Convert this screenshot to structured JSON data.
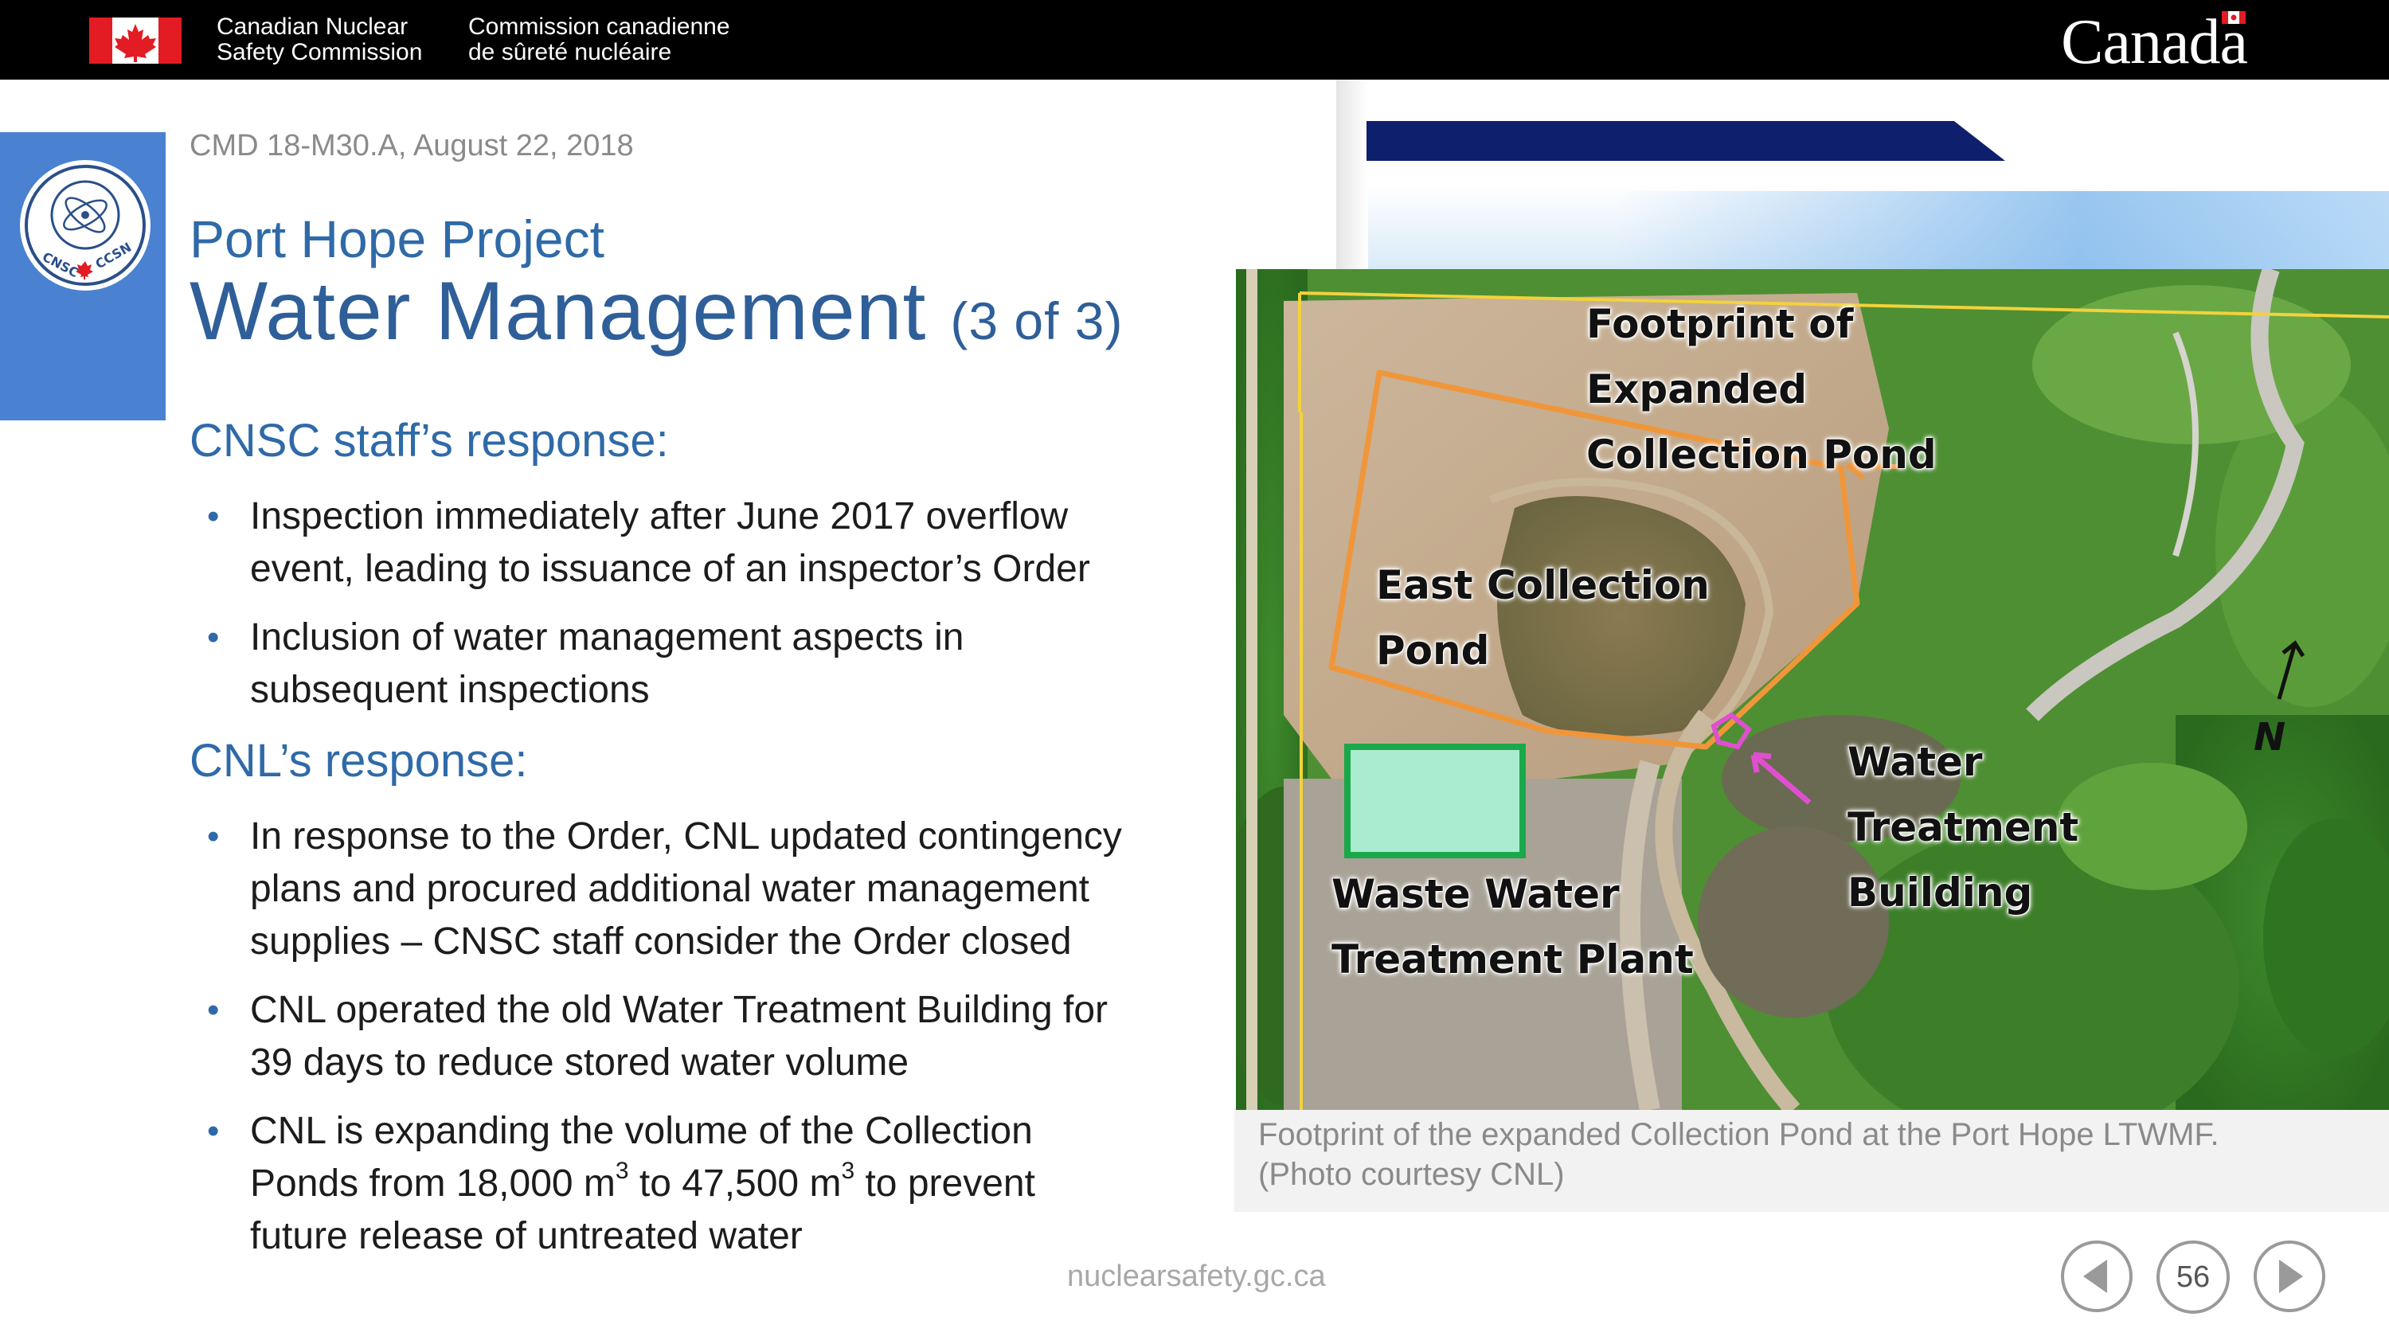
{
  "header": {
    "agency_en_line1": "Canadian Nuclear",
    "agency_en_line2": "Safety Commission",
    "agency_fr_line1": "Commission canadienne",
    "agency_fr_line2": "de sûreté nucléaire",
    "wordmark": "Canada",
    "flag_icon": "canada-flag-icon"
  },
  "logo": {
    "icon": "cnsc-ccsn-seal-icon",
    "text_left": "CNSC",
    "text_right": "CCSN"
  },
  "slide": {
    "reference": "CMD 18-M30.A, August 22, 2018",
    "project": "Port Hope Project",
    "title": "Water Management",
    "title_suffix": "(3 of 3)"
  },
  "sections": [
    {
      "heading": "CNSC staff’s response:",
      "bullets": [
        [
          "Inspection immediately after June 2017 overflow",
          "event, leading to issuance of an inspector’s Order"
        ],
        [
          "Inclusion of water management aspects in",
          "subsequent inspections"
        ]
      ]
    },
    {
      "heading": "CNL’s response:",
      "bullets": [
        [
          "In response to the Order, CNL updated contingency",
          "plans and procured additional water management",
          "supplies – CNSC staff consider the Order closed"
        ],
        [
          "CNL operated the old Water Treatment Building for",
          "39 days to reduce stored water volume"
        ]
      ],
      "volume_bullet": {
        "line1": "CNL is expanding the volume of the Collection",
        "line2_a": "Ponds from 18,000 m",
        "sup1": "3",
        "line2_b": " to 47,500 m",
        "sup2": "3",
        "line2_c": " to prevent",
        "line3": "future release of untreated water"
      }
    }
  ],
  "photo": {
    "labels": {
      "footprint": [
        "Footprint of",
        "Expanded",
        "Collection  Pond"
      ],
      "east_pond": [
        "East Collection",
        "Pond"
      ],
      "water_treatment": [
        "Water",
        "Treatment",
        "Building"
      ],
      "waste_water": [
        "Waste Water",
        "Treatment Plant"
      ],
      "north": "N"
    },
    "caption_line1": "Footprint of the expanded Collection Pond at the Port Hope LTWMF.",
    "caption_line2": "(Photo courtesy CNL)",
    "colors": {
      "footprint_outline": "#f0963a",
      "wwtp_outline": "#1aa84a",
      "wwtp_fill": "#a9ecd0",
      "building_marker": "#e04fd0"
    }
  },
  "footer": {
    "url": "nuclearsafety.gc.ca",
    "page_number": "56",
    "prev_icon": "previous-arrow-icon",
    "next_icon": "next-arrow-icon"
  }
}
